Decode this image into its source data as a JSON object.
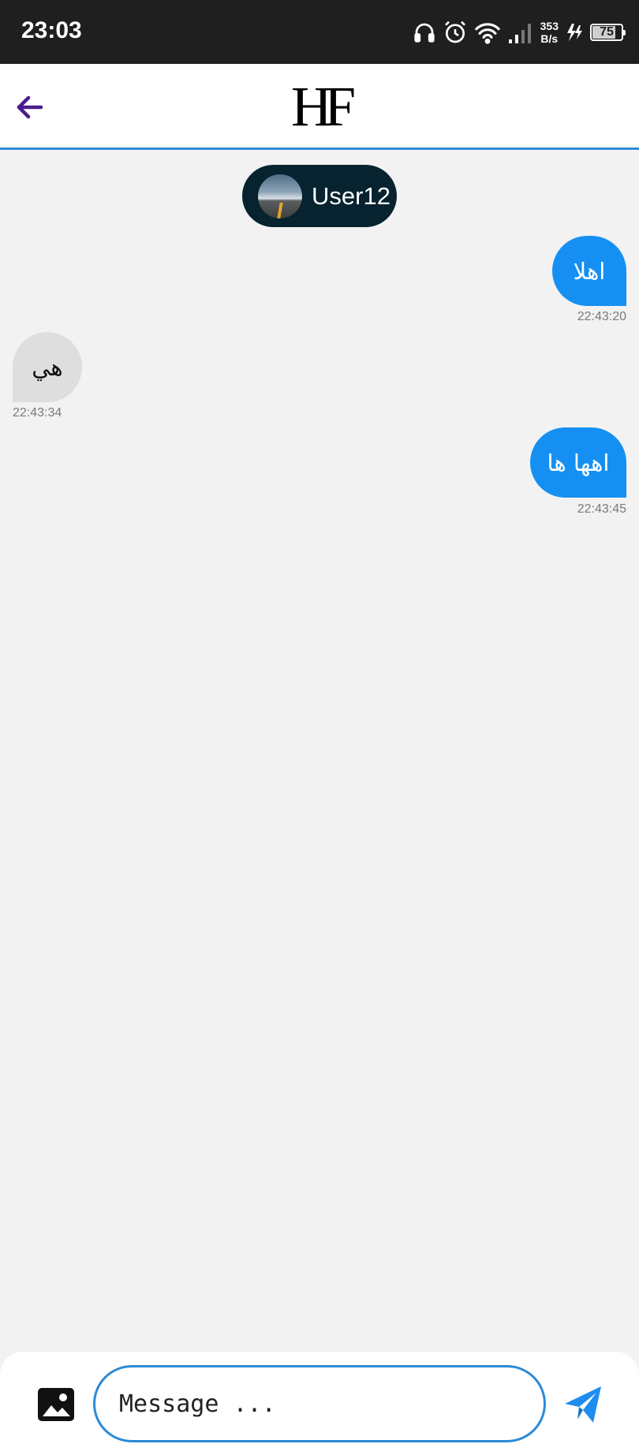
{
  "status_bar": {
    "time": "23:03",
    "net_speed_value": "353",
    "net_speed_unit": "B/s",
    "battery": "75",
    "icons": [
      "headphones-icon",
      "alarm-icon",
      "wifi-icon",
      "signal-icon",
      "charging-icon",
      "battery-icon"
    ]
  },
  "header": {
    "back_icon": "arrow-left-icon",
    "logo": "HF",
    "accent_color": "#2b8ad8",
    "back_color": "#4a1d8c"
  },
  "chat": {
    "peer_name": "User12",
    "messages": [
      {
        "direction": "outgoing",
        "text": "اهلا",
        "time": "22:43:20"
      },
      {
        "direction": "incoming",
        "text": "هي",
        "time": "22:43:34"
      },
      {
        "direction": "outgoing",
        "text": "اهها ها",
        "time": "22:43:45"
      }
    ],
    "outgoing_color": "#1590f2",
    "incoming_color": "#dedede"
  },
  "composer": {
    "placeholder": "Message ...",
    "gallery_icon": "image-icon",
    "send_icon": "send-icon",
    "send_color": "#1f8cf0"
  }
}
